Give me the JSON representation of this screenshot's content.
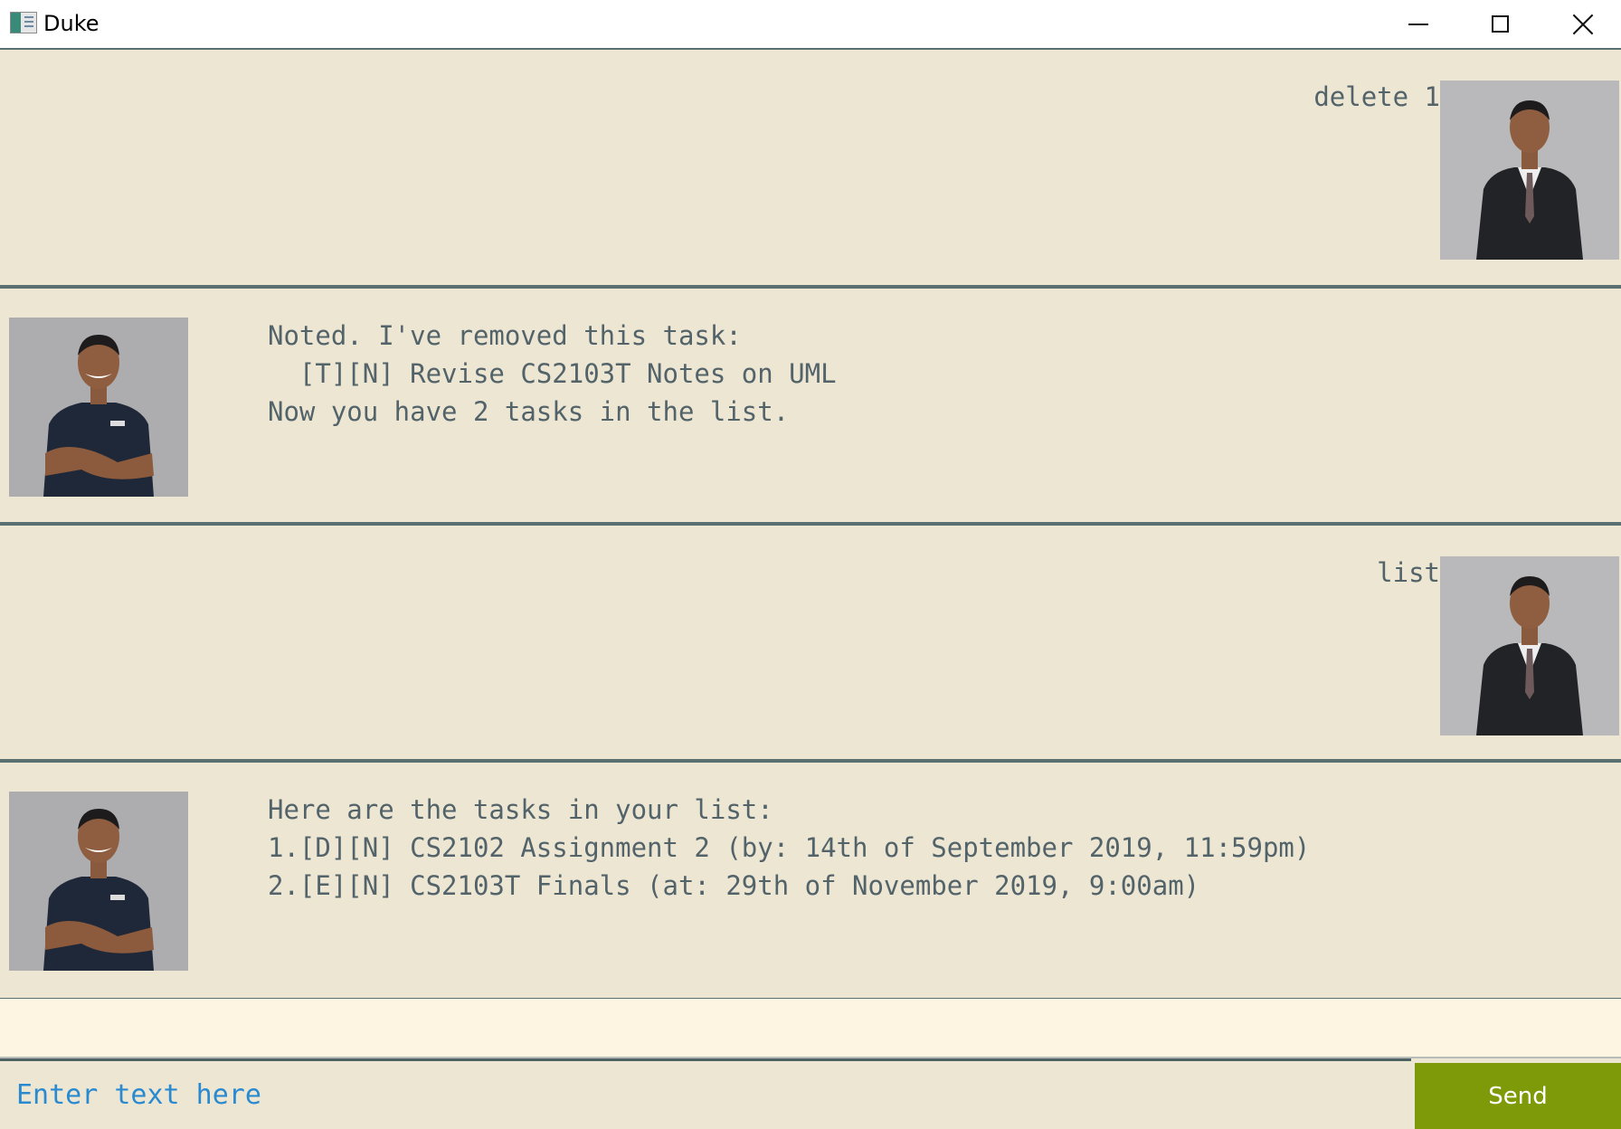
{
  "window": {
    "title": "Duke"
  },
  "messages": [
    {
      "sender": "user",
      "text": "delete 1"
    },
    {
      "sender": "duke",
      "text": "Noted. I've removed this task:\n  [T][N] Revise CS2103T Notes on UML\nNow you have 2 tasks in the list."
    },
    {
      "sender": "user",
      "text": "list"
    },
    {
      "sender": "duke",
      "text": "Here are the tasks in your list:\n1.[D][N] CS2102 Assignment 2 (by: 14th of September 2019, 11:59pm)\n2.[E][N] CS2103T Finals (at: 29th of November 2019, 9:00am)"
    }
  ],
  "input": {
    "placeholder": "Enter text here",
    "value": ""
  },
  "send_button": {
    "label": "Send"
  },
  "colors": {
    "background": "#ede6d3",
    "text": "#53636a",
    "divider": "#5b7070",
    "send_button": "#7e9a08",
    "placeholder": "#2a8ad0"
  },
  "icons": {
    "app": "duke-app-icon",
    "minimize": "minimize-icon",
    "maximize": "maximize-icon",
    "close": "close-icon"
  }
}
